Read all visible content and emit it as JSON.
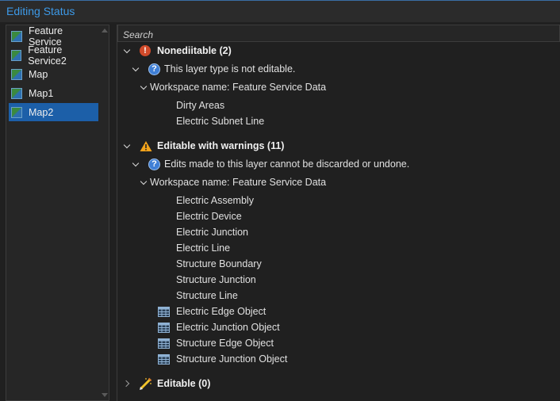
{
  "window": {
    "title": "Editing Status"
  },
  "maps": [
    {
      "label": "Feature Service",
      "selected": false
    },
    {
      "label": "Feature Service2",
      "selected": false
    },
    {
      "label": "Map",
      "selected": false
    },
    {
      "label": "Map1",
      "selected": false
    },
    {
      "label": "Map2",
      "selected": true
    }
  ],
  "search": {
    "placeholder": "Search"
  },
  "groups": {
    "noneditable": {
      "label": "Nonediitable (2)",
      "reason": "This layer type is not editable.",
      "workspace": "Workspace name: Feature Service Data",
      "layers": [
        "Dirty Areas",
        "Electric Subnet Line"
      ]
    },
    "warnings": {
      "label": "Editable with warnings (11)",
      "reason": "Edits made to this layer cannot be discarded or undone.",
      "workspace": "Workspace name: Feature Service Data",
      "layers": [
        "Electric Assembly",
        "Electric Device",
        "Electric Junction",
        "Electric Line",
        "Structure Boundary",
        "Structure Junction",
        "Structure Line"
      ],
      "tables": [
        "Electric Edge Object",
        "Electric Junction Object",
        "Structure Edge Object",
        "Structure Junction Object"
      ]
    },
    "editable": {
      "label": "Editable (0)"
    }
  },
  "colors": {
    "accent": "#3d9ae8",
    "selection": "#1c5fa8",
    "error": "#d04a2a",
    "info": "#3f7fd6",
    "warning": "#f2a31b"
  }
}
